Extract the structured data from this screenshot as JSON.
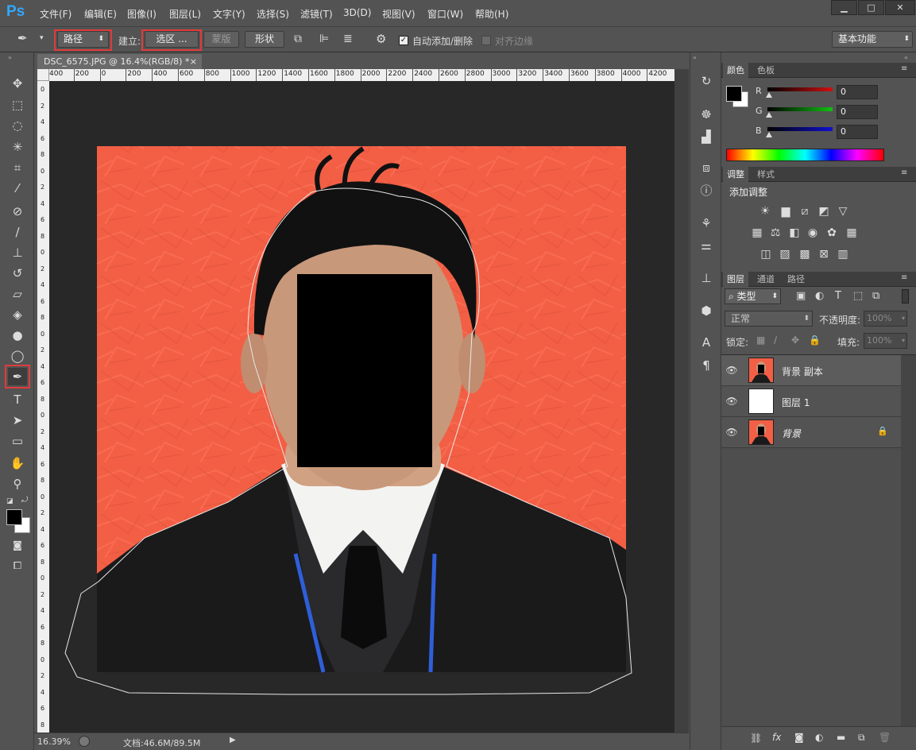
{
  "app": {
    "logo": "Ps"
  },
  "menu": [
    "文件(F)",
    "编辑(E)",
    "图像(I)",
    "图层(L)",
    "文字(Y)",
    "选择(S)",
    "滤镜(T)",
    "3D(D)",
    "视图(V)",
    "窗口(W)",
    "帮助(H)"
  ],
  "window_controls": {
    "minimize": "▁",
    "maximize": "□",
    "close": "✕"
  },
  "options": {
    "mode_value": "路径",
    "build_label": "建立:",
    "selection_button": "选区 ...",
    "mask_button": "蒙版",
    "shape_button": "形状",
    "auto_add_delete_label": "自动添加/删除",
    "auto_add_delete_checked": true,
    "align_edges_label": "对齐边缘",
    "workspace": "基本功能"
  },
  "document": {
    "tab_title": "DSC_6575.JPG @ 16.4%(RGB/8) *",
    "close": "×",
    "zoom": "16.39%",
    "doc_size": "文档:46.6M/89.5M",
    "ruler_h_ticks": [
      "400",
      "200",
      "0",
      "200",
      "400",
      "600",
      "800",
      "1000",
      "1200",
      "1400",
      "1600",
      "1800",
      "2000",
      "2200",
      "2400",
      "2600",
      "2800",
      "3000",
      "3200",
      "3400",
      "3600",
      "3800",
      "4000",
      "4200"
    ],
    "ruler_v_ticks": [
      "0",
      "2",
      "4",
      "6",
      "8",
      "0",
      "2",
      "4",
      "6",
      "8",
      "0",
      "2",
      "4",
      "6",
      "8",
      "0",
      "2",
      "4",
      "6",
      "8",
      "0",
      "2",
      "4",
      "6",
      "8",
      "0",
      "2",
      "4",
      "6",
      "8",
      "0",
      "2",
      "4",
      "6",
      "8",
      "0",
      "2",
      "4",
      "6",
      "8"
    ],
    "background_color": "#f25f45"
  },
  "tools": [
    "move-tool",
    "marquee-tool",
    "lasso-tool",
    "magic-wand-tool",
    "crop-tool",
    "eyedropper-tool",
    "healing-brush-tool",
    "brush-tool",
    "clone-stamp-tool",
    "history-brush-tool",
    "eraser-tool",
    "paint-bucket-tool",
    "blur-tool",
    "dodge-tool",
    "pen-tool",
    "type-tool",
    "path-selection-tool",
    "rectangle-tool",
    "hand-tool",
    "zoom-tool"
  ],
  "color_panel": {
    "tabs": [
      "颜色",
      "色板"
    ],
    "channels": [
      {
        "label": "R",
        "value": "0",
        "color": "#d01010"
      },
      {
        "label": "G",
        "value": "0",
        "color": "#10c010"
      },
      {
        "label": "B",
        "value": "0",
        "color": "#1010d0"
      }
    ]
  },
  "adjust_panel": {
    "tabs": [
      "调整",
      "样式"
    ],
    "title": "添加调整"
  },
  "layers_panel": {
    "tabs": [
      "图层",
      "通道",
      "路径"
    ],
    "filter_kind": "类型",
    "blend_mode": "正常",
    "opacity_label": "不透明度:",
    "opacity_value": "100%",
    "lock_label": "锁定:",
    "fill_label": "填充:",
    "fill_value": "100%",
    "layers": [
      {
        "name": "背景 副本",
        "thumb": "photo"
      },
      {
        "name": "图层 1",
        "thumb": "white"
      },
      {
        "name": "背景",
        "thumb": "photo",
        "locked": true
      }
    ],
    "footer_icons": [
      "link-icon",
      "fx-icon",
      "mask-icon",
      "adjustment-icon",
      "folder-icon",
      "new-layer-icon",
      "trash-icon"
    ]
  }
}
